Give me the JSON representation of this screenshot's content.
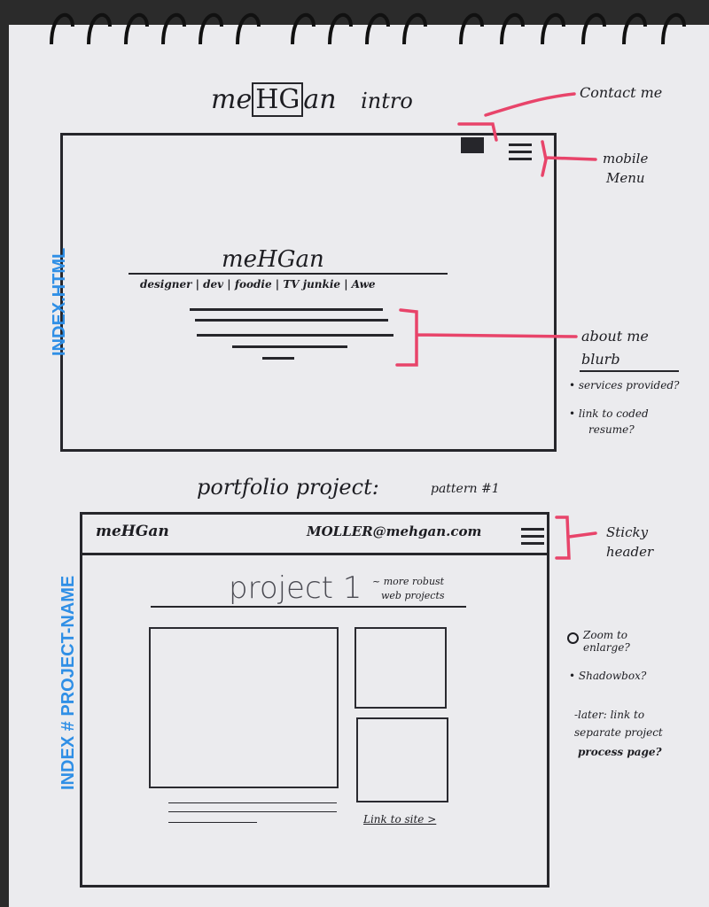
{
  "sketch1": {
    "title_pre": "me",
    "title_box": "HG",
    "title_post": "an",
    "title_suffix": "intro",
    "logo": "meHGan",
    "tagline": "designer | dev | foodie | TV junkie | Awe",
    "side_label": "INDEX.HTML"
  },
  "annotations1": {
    "contact": "Contact me",
    "mobile_menu_line1": "mobile",
    "mobile_menu_line2": "Menu",
    "about_line1": "about me",
    "about_line2": "blurb",
    "bullet1": "• services provided?",
    "bullet2_line1": "• link to coded",
    "bullet2_line2": "resume?"
  },
  "sketch2": {
    "title": "portfolio project:",
    "pattern": "pattern #1",
    "header_logo": "meHGan",
    "header_email": "MOLLER@mehgan.com",
    "project_title": "project 1",
    "project_note_line1": "~ more robust",
    "project_note_line2": "web projects",
    "link_label": "Link to site >",
    "side_label": "INDEX # PROJECT-NAME"
  },
  "annotations2": {
    "sticky_line1": "Sticky",
    "sticky_line2": "header",
    "zoom": "Zoom to enlarge?",
    "shadowbox": "• Shadowbox?",
    "later_line1": "-later: link to",
    "later_line2": "separate project",
    "later_line3": "process page?"
  },
  "colors": {
    "ink": "#1d1d22",
    "highlighter_pink": "#e8446a",
    "marker_blue": "#2f8fe6",
    "paper": "#ebebee"
  }
}
